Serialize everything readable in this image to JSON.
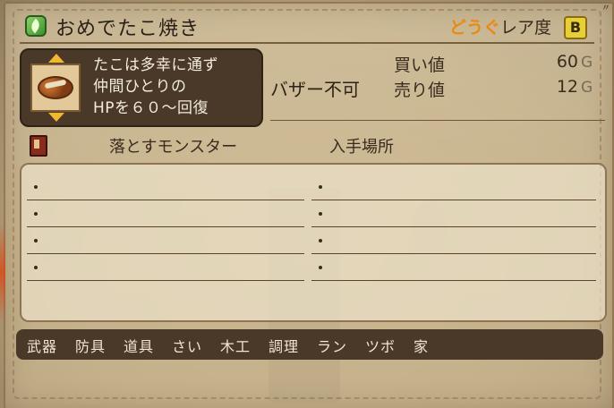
{
  "item": {
    "name": "おめでたこ焼き",
    "icon": "leaf-icon"
  },
  "rarity": {
    "category": "どうぐ",
    "label": "レア度",
    "grade": "B"
  },
  "description": {
    "lines": [
      "たこは多幸に通ず",
      "仲間ひとりの",
      "HPを６０～回復"
    ]
  },
  "bazaar": {
    "status": "バザー不可"
  },
  "prices": {
    "buy_label": "買い値",
    "buy_value": "60",
    "sell_label": "売り値",
    "sell_value": "12",
    "unit": "G"
  },
  "sections": {
    "monster_header": "落とすモンスター",
    "location_header": "入手場所"
  },
  "tabs": [
    "武器",
    "防具",
    "道具",
    "さい",
    "木工",
    "調理",
    "ラン",
    "ツボ",
    "家"
  ],
  "colors": {
    "accent_orange": "#e98a14",
    "grade_yellow": "#e7cf37",
    "panel_dark": "#4a3829"
  }
}
